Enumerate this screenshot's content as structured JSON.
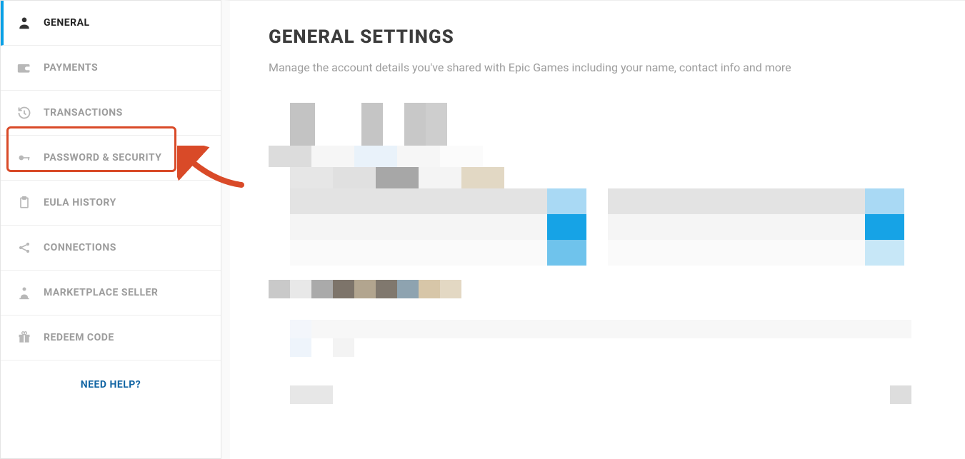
{
  "sidebar": {
    "items": [
      {
        "key": "general",
        "label": "GENERAL",
        "icon": "person-icon",
        "active": true
      },
      {
        "key": "payments",
        "label": "PAYMENTS",
        "icon": "wallet-icon",
        "active": false
      },
      {
        "key": "transactions",
        "label": "TRANSACTIONS",
        "icon": "history-icon",
        "active": false
      },
      {
        "key": "password-security",
        "label": "PASSWORD & SECURITY",
        "icon": "key-icon",
        "active": false
      },
      {
        "key": "eula-history",
        "label": "EULA HISTORY",
        "icon": "clipboard-icon",
        "active": false
      },
      {
        "key": "connections",
        "label": "CONNECTIONS",
        "icon": "share-icon",
        "active": false
      },
      {
        "key": "marketplace-seller",
        "label": "MARKETPLACE SELLER",
        "icon": "seller-icon",
        "active": false
      },
      {
        "key": "redeem-code",
        "label": "REDEEM CODE",
        "icon": "gift-icon",
        "active": false
      }
    ],
    "help_label": "NEED HELP?"
  },
  "main": {
    "title": "GENERAL SETTINGS",
    "subtitle": "Manage the account details you've shared with Epic Games including your name, contact info and more"
  },
  "annotation": {
    "highlighted_item": "password-security",
    "arrow_color": "#d94a28"
  }
}
